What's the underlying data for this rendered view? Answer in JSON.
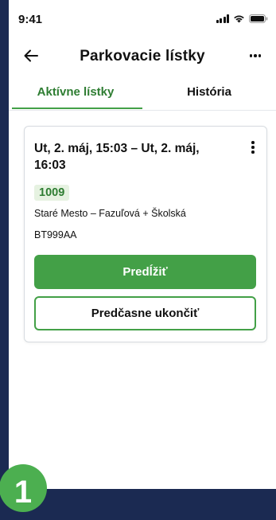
{
  "status_bar": {
    "time": "9:41"
  },
  "header": {
    "title": "Parkovacie lístky"
  },
  "tabs": [
    {
      "label": "Aktívne lístky",
      "active": true
    },
    {
      "label": "História",
      "active": false
    }
  ],
  "ticket": {
    "time_range": "Ut, 2. máj, 15:03 – Ut, 2. máj, 16:03",
    "zone_code": "1009",
    "zone_address": "Staré Mesto – Fazuľová + Školská",
    "plate": "BT999AA",
    "extend_label": "Predĺžiť",
    "end_label": "Predčasne ukončiť"
  },
  "step_badge": "1",
  "colors": {
    "accent": "#43a047",
    "accent_dark": "#2e7d32",
    "badge_bg": "#e6f2e1",
    "backdrop": "#1b2a52"
  }
}
